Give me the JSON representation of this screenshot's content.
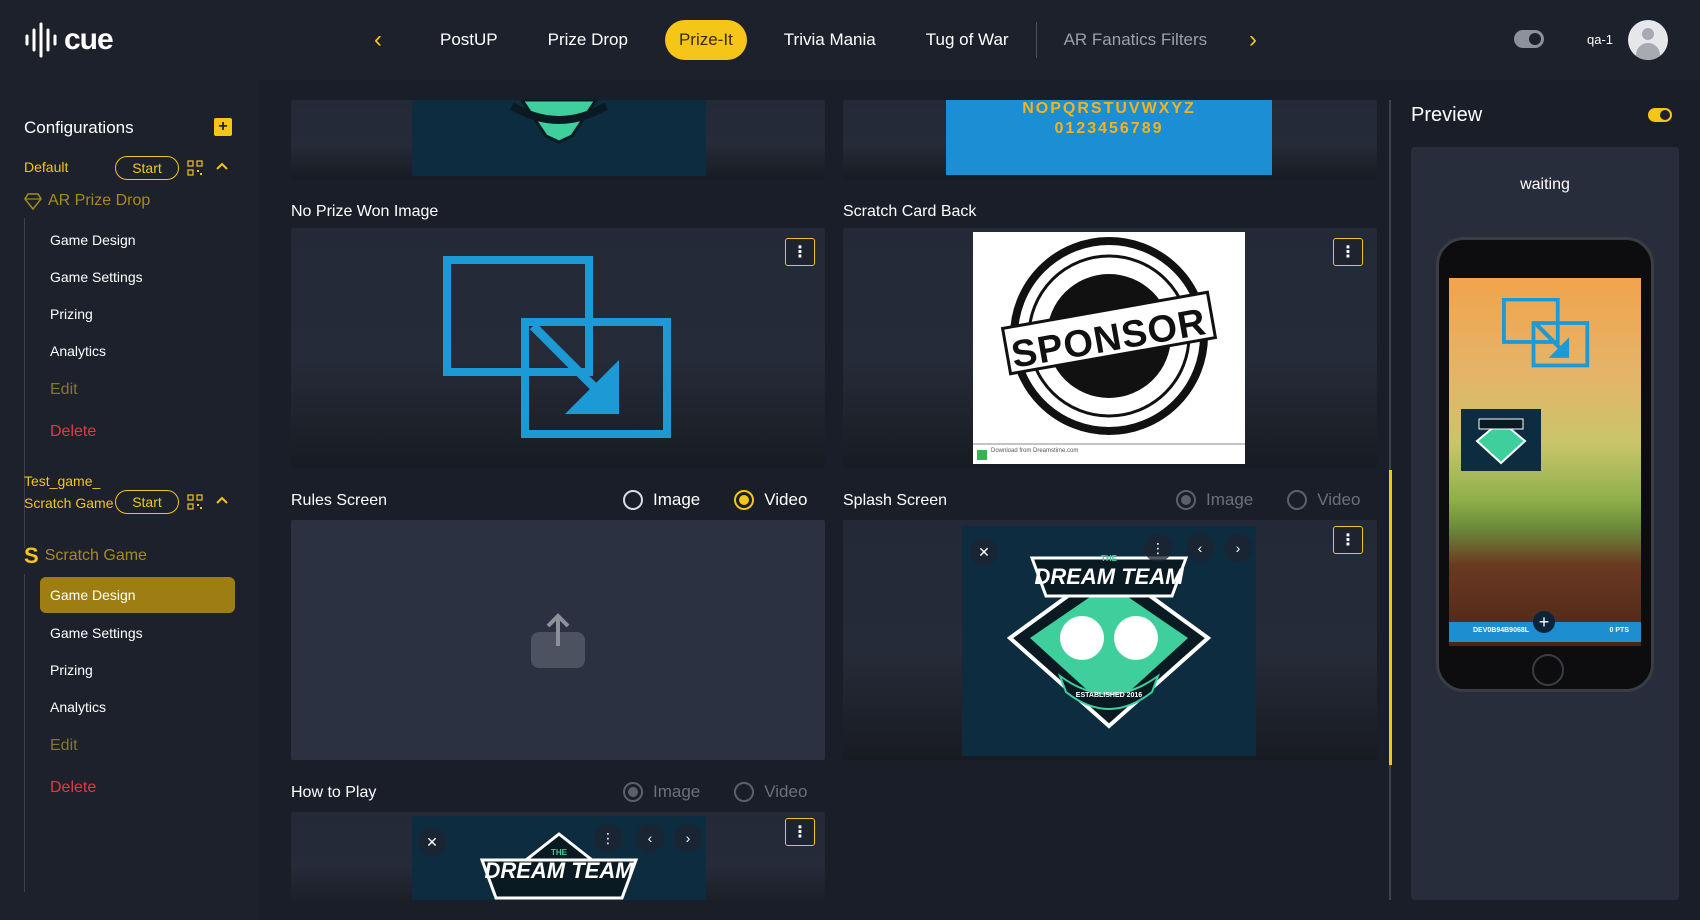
{
  "brand": {
    "name": "cue"
  },
  "nav": {
    "tabs": [
      {
        "label": "PostUP",
        "active": false
      },
      {
        "label": "Prize Drop",
        "active": false
      },
      {
        "label": "Prize-It",
        "active": true
      },
      {
        "label": "Trivia Mania",
        "active": false
      },
      {
        "label": "Tug of War",
        "active": false
      },
      {
        "label": "AR Fanatics Filters",
        "active": false
      }
    ],
    "username": "qa-1"
  },
  "sidebar": {
    "title": "Configurations",
    "configs": [
      {
        "name": "Default",
        "start_label": "Start",
        "game_type": "AR Prize Drop",
        "items": [
          "Game Design",
          "Game Settings",
          "Prizing",
          "Analytics"
        ],
        "edit_label": "Edit",
        "delete_label": "Delete"
      },
      {
        "name": "Test_game_ Scratch Game",
        "start_label": "Start",
        "game_type": "Scratch Game",
        "items": [
          "Game Design",
          "Game Settings",
          "Prizing",
          "Analytics"
        ],
        "active_item": "Game Design",
        "edit_label": "Edit",
        "delete_label": "Delete"
      }
    ]
  },
  "main": {
    "no_prize_label": "No Prize Won Image",
    "scratch_back_label": "Scratch Card Back",
    "rules_label": "Rules Screen",
    "splash_label": "Splash Screen",
    "how_to_play_label": "How to Play",
    "image_option": "Image",
    "video_option": "Video",
    "font_preview_line1": "NOPQRSTUVWXYZ",
    "font_preview_line2": "0123456789",
    "sponsor_text": "SPONSOR",
    "dream_team_small": "THE",
    "dream_team_text": "DREAM TEAM",
    "established_text": "ESTABLISHED 2016",
    "sponsor_footer": "Download from Dreamstime.com"
  },
  "preview": {
    "title": "Preview",
    "status": "waiting",
    "phone_bar_text": "DEV0B94B9068L",
    "phone_points": "0 PTS"
  },
  "colors": {
    "accent": "#f5c518",
    "background": "#1a1e28",
    "danger": "#e23b3b",
    "link_blue": "#1c9ad6",
    "teal": "#3ecf9c"
  }
}
